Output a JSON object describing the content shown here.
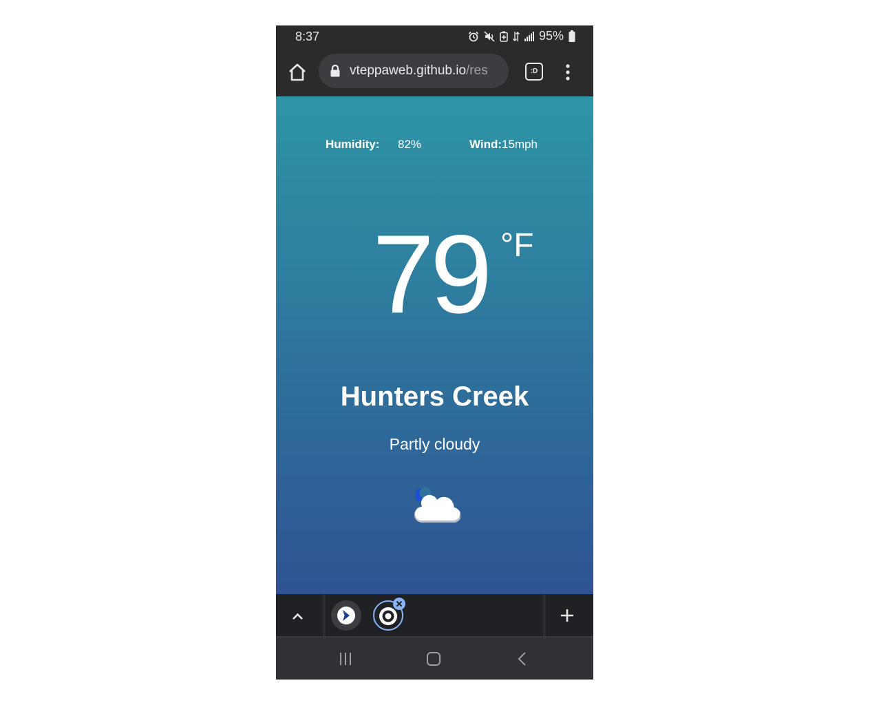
{
  "status_bar": {
    "time": "8:37",
    "battery_percent": "95%",
    "icons": [
      "alarm-icon",
      "mute-icon",
      "battery-saver-icon",
      "data-icon",
      "signal-icon",
      "battery-icon"
    ]
  },
  "toolbar": {
    "url_main": "vteppaweb.github.io",
    "url_rest": "/res",
    "tab_count_label": ":D"
  },
  "weather": {
    "humidity_label": "Humidity:",
    "humidity_value": "82%",
    "wind_label": "Wind:",
    "wind_value": "15mph",
    "temperature": "79",
    "unit": "°F",
    "city": "Hunters Creek",
    "condition": "Partly cloudy",
    "icon": "partly-cloudy-night-icon"
  },
  "colors": {
    "gradient_top": "#2e95a5",
    "gradient_bottom": "#2f5393",
    "browser_chrome": "#2b2b2d",
    "accent": "#8ab4f8"
  }
}
